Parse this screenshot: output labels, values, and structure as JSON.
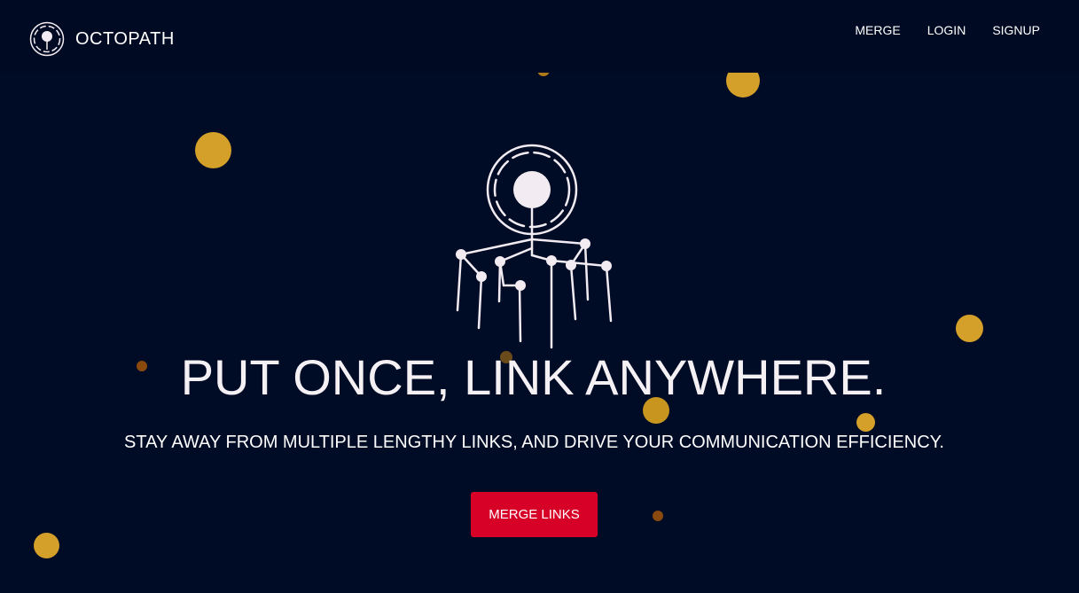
{
  "navbar": {
    "brand_name": "OCTOPATH",
    "links": [
      {
        "label": "MERGE"
      },
      {
        "label": "LOGIN"
      },
      {
        "label": "SIGNUP"
      }
    ]
  },
  "hero": {
    "title": "PUT ONCE, LINK ANYWHERE.",
    "subtitle": "STAY AWAY FROM MULTIPLE LENGTHY LINKS, AND DRIVE YOUR COMMUNICATION EFFICIENCY.",
    "cta_label": "MERGE LINKS"
  },
  "colors": {
    "background": "#000b26",
    "accent": "#d70127",
    "dot_gold": "#d4a02a",
    "dot_brown": "#8a4a0e",
    "graphic": "#f2ecf2"
  },
  "icons": {
    "brand": "octopus-logo-icon",
    "hero": "octopus-links-illustration"
  }
}
